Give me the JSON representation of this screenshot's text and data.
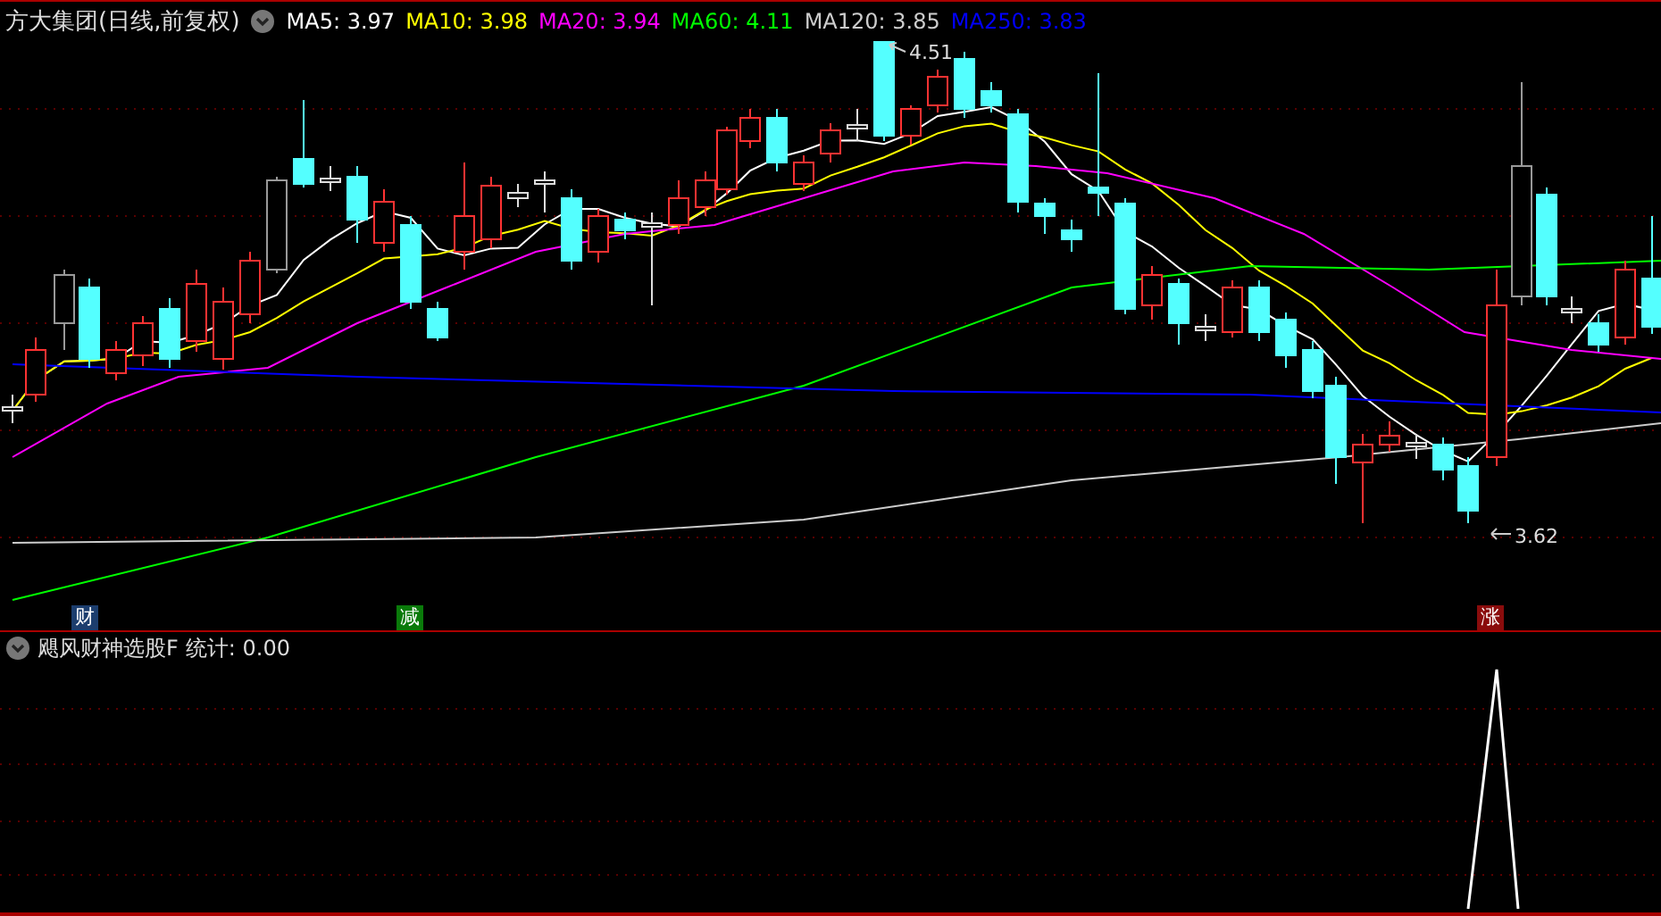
{
  "chart_title": "方大集团(日线,前复权)",
  "moving_averages": [
    {
      "label": "MA5: 3.97",
      "color": "#ffffff"
    },
    {
      "label": "MA10: 3.98",
      "color": "#ffff00"
    },
    {
      "label": "MA20: 3.94",
      "color": "#ff00ff"
    },
    {
      "label": "MA60: 4.11",
      "color": "#00ff00"
    },
    {
      "label": "MA120: 3.85",
      "color": "#cccccc"
    },
    {
      "label": "MA250: 3.83",
      "color": "#0000ff"
    }
  ],
  "high_label": "4.51",
  "low_label": "3.62",
  "signals": [
    {
      "text": "财",
      "color": "#1c3e6e"
    },
    {
      "text": "减",
      "color": "#0a7a0a"
    },
    {
      "text": "涨",
      "color": "#8a0c0c"
    }
  ],
  "indicator": {
    "title": "飓风财神选股F",
    "stat": "统计: 0.00"
  }
}
